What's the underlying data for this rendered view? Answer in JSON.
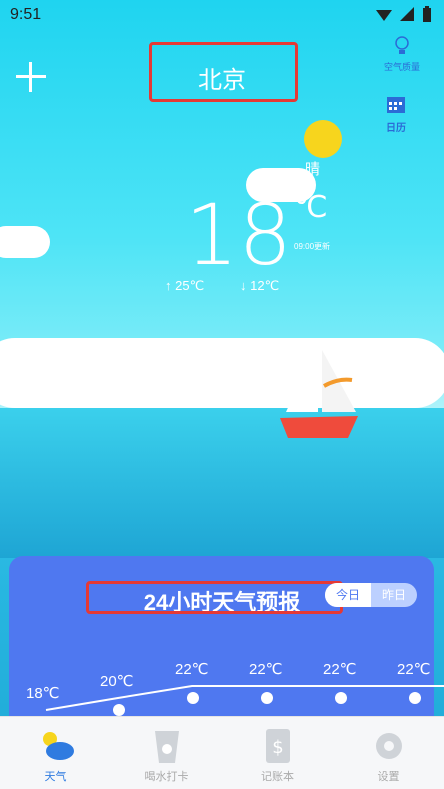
{
  "status": {
    "time": "9:51"
  },
  "header": {
    "city": "北京",
    "air_quality_label": "空气质量",
    "calendar_label": "日历"
  },
  "weather": {
    "condition": "晴",
    "temperature": "18",
    "unit": "℃",
    "update_time": "09:00更新",
    "high": "↑ 25℃",
    "low": "↓ 12℃"
  },
  "forecast": {
    "title": "24小时天气预报",
    "tab_today": "今日",
    "tab_yesterday": "昨日",
    "points": [
      "18℃",
      "20℃",
      "22℃",
      "22℃",
      "22℃",
      "22℃"
    ]
  },
  "nav": {
    "weather": "天气",
    "water": "喝水打卡",
    "ledger": "记账本",
    "settings": "设置"
  },
  "colors": {
    "accent": "#4f78f0",
    "nav_active": "#2f7be0",
    "highlight_box": "#e53935"
  }
}
